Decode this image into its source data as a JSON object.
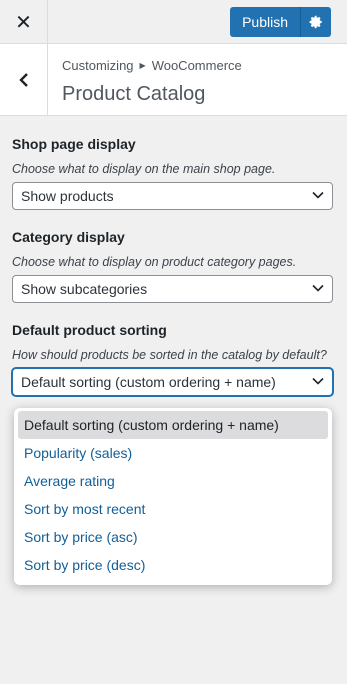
{
  "topbar": {
    "close_icon": "close-icon",
    "publish_label": "Publish",
    "settings_icon": "gear-icon",
    "accent": "#2271b1"
  },
  "header": {
    "back_icon": "chevron-left-icon",
    "breadcrumb": [
      "Customizing",
      "WooCommerce"
    ],
    "title": "Product Catalog"
  },
  "controls": [
    {
      "title": "Shop page display",
      "description": "Choose what to display on the main shop page.",
      "value": "Show products"
    },
    {
      "title": "Category display",
      "description": "Choose what to display on product category pages.",
      "value": "Show subcategories"
    },
    {
      "title": "Default product sorting",
      "description": "How should products be sorted in the catalog by default?",
      "value": "Default sorting (custom ordering + name)"
    }
  ],
  "sorting_options": [
    "Default sorting (custom ordering + name)",
    "Popularity (sales)",
    "Average rating",
    "Sort by most recent",
    "Sort by price (asc)",
    "Sort by price (desc)"
  ]
}
